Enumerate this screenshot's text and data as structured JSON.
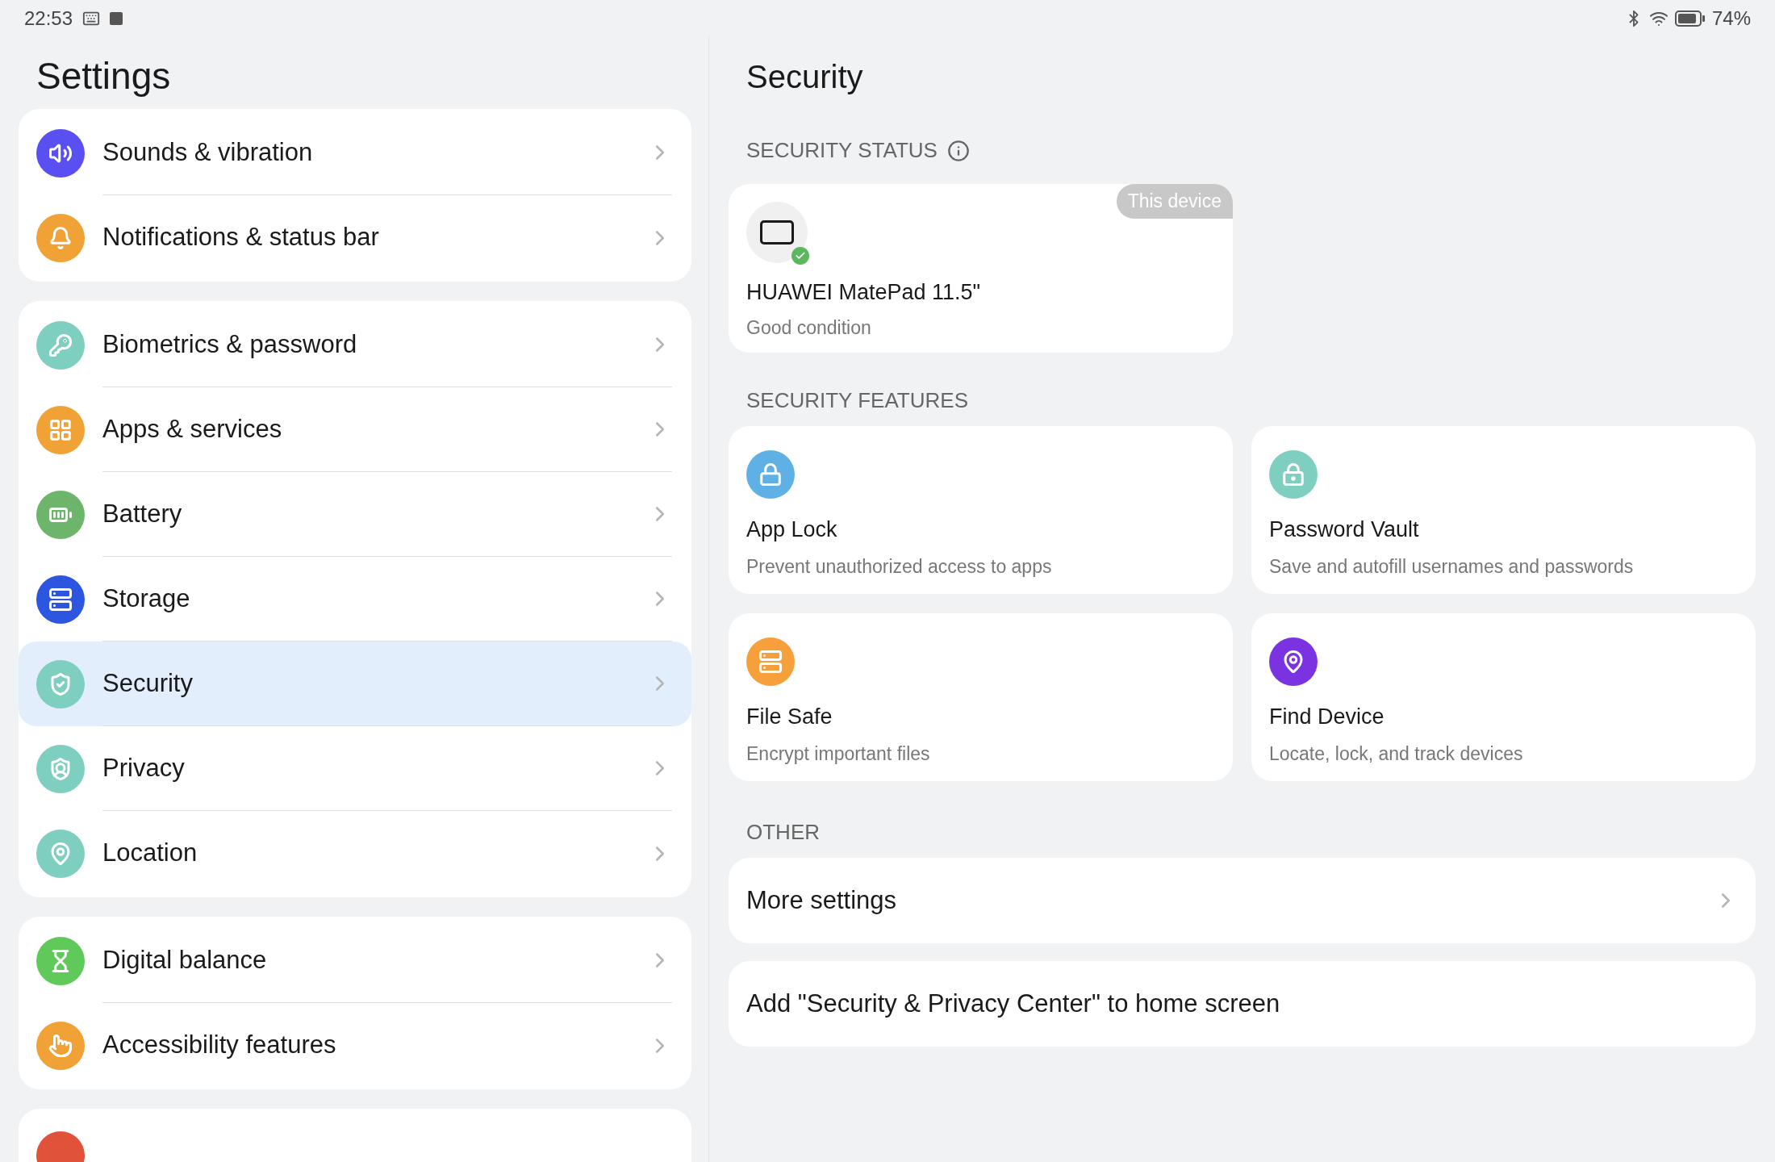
{
  "status_bar": {
    "time": "22:53",
    "battery": "74%"
  },
  "sidebar": {
    "title": "Settings",
    "groups": [
      [
        {
          "label": "Sounds & vibration",
          "selected": false
        },
        {
          "label": "Notifications & status bar",
          "selected": false
        }
      ],
      [
        {
          "label": "Biometrics & password",
          "selected": false
        },
        {
          "label": "Apps & services",
          "selected": false
        },
        {
          "label": "Battery",
          "selected": false
        },
        {
          "label": "Storage",
          "selected": false
        },
        {
          "label": "Security",
          "selected": true
        },
        {
          "label": "Privacy",
          "selected": false
        },
        {
          "label": "Location",
          "selected": false
        }
      ],
      [
        {
          "label": "Digital balance",
          "selected": false
        },
        {
          "label": "Accessibility features",
          "selected": false
        }
      ]
    ]
  },
  "content": {
    "title": "Security",
    "status_section": {
      "heading": "SECURITY STATUS",
      "device": {
        "badge": "This device",
        "name": "HUAWEI MatePad 11.5\"",
        "condition": "Good condition"
      }
    },
    "features_section": {
      "heading": "SECURITY FEATURES",
      "items": [
        {
          "title": "App Lock",
          "description": "Prevent unauthorized access to apps"
        },
        {
          "title": "Password Vault",
          "description": "Save and autofill usernames and passwords"
        },
        {
          "title": "File Safe",
          "description": "Encrypt important files"
        },
        {
          "title": "Find Device",
          "description": "Locate, lock, and track devices"
        }
      ]
    },
    "other_section": {
      "heading": "OTHER",
      "items": [
        {
          "label": "More settings",
          "kind": "link"
        },
        {
          "label": "Add \"Security & Privacy Center\" to home screen",
          "kind": "action"
        }
      ]
    }
  }
}
